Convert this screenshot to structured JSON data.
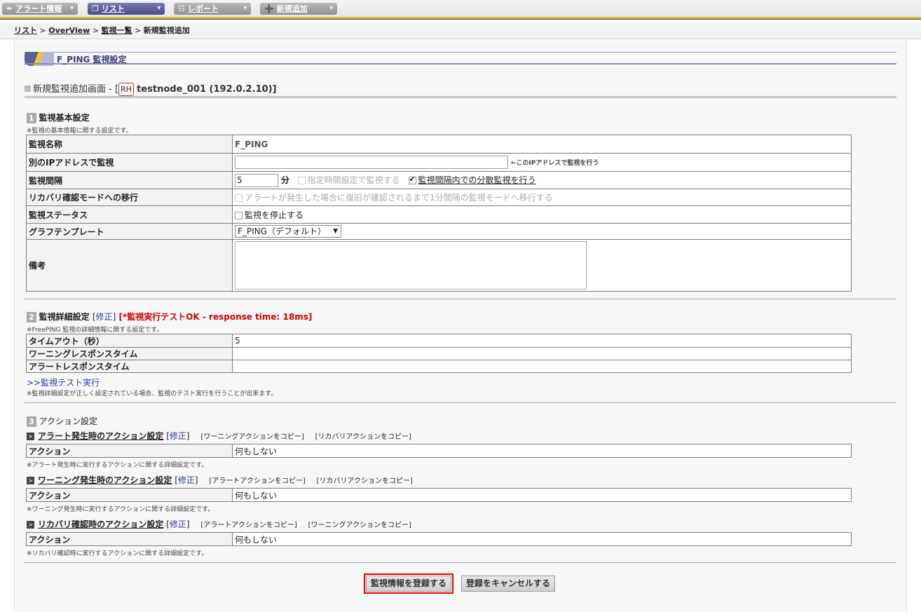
{
  "nav": {
    "tabs": [
      {
        "icon": "✒",
        "label": "アラート情報"
      },
      {
        "icon": "❐",
        "label": "リスト"
      },
      {
        "icon": "☷",
        "label": "レポート"
      },
      {
        "icon": "➕",
        "label": "新規追加"
      }
    ],
    "arrow": "▾"
  },
  "breadcrumb": {
    "items": [
      "リスト",
      "OverView",
      "監視一覧"
    ],
    "sep": ">",
    "current": "新規監視追加"
  },
  "page": {
    "title": "F_PING 監視設定",
    "subtitle_prefix": "新規監視追加画面 - [",
    "host_badge": "RH",
    "host_text": "testnode_001 (192.0.2.10)]"
  },
  "basic": {
    "num": "1",
    "title": "監視基本設定",
    "note": "※監視の基本情報に関する設定です。",
    "rows": {
      "name_label": "監視名称",
      "name_value": "F_PING",
      "altip_label": "別のIPアドレスで監視",
      "altip_hint": "←このIPアドレスで監視を行う",
      "interval_label": "監視間隔",
      "interval_value": "5",
      "interval_unit": "分",
      "interval_opt1": "指定時間設定で監視する",
      "interval_opt2": "監視間隔内での分散監視を行う",
      "recovery_label": "リカバリ確認モードへの移行",
      "recovery_opt": "アラートが発生した場合に復旧が確認されるまで1分間隔の監視モードへ移行する",
      "status_label": "監視ステータス",
      "status_opt": "監視を停止する",
      "graph_label": "グラフテンプレート",
      "graph_value": "F_PING（デフォルト）",
      "memo_label": "備考"
    }
  },
  "detail": {
    "num": "2",
    "title": "監視詳細設定",
    "edit": "修正",
    "test_result": "[*監視実行テストOK - response time: 18ms]",
    "note": "※FreePING 監視の詳細情報に関する設定です。",
    "rows": [
      {
        "label": "タイムアウト（秒）",
        "value": "5"
      },
      {
        "label": "ワーニングレスポンスタイム",
        "value": ""
      },
      {
        "label": "アラートレスポンスタイム",
        "value": ""
      }
    ],
    "test_link": ">>監視テスト実行",
    "test_note": "※監視詳細設定が正しく設定されている場合、監視のテスト実行を行うことが出来ます。"
  },
  "action": {
    "num": "3",
    "title": "アクション設定",
    "groups": [
      {
        "name": "アラート発生時のアクション設定",
        "edit": "修正",
        "copy1": "ワーニングアクションをコピー",
        "copy2": "リカバリアクションをコピー",
        "label": "アクション",
        "value": "何もしない",
        "note": "※アラート発生時に実行するアクションに関する詳細設定です。"
      },
      {
        "name": "ワーニング発生時のアクション設定",
        "edit": "修正",
        "copy1": "アラートアクションをコピー",
        "copy2": "リカバリアクションをコピー",
        "label": "アクション",
        "value": "何もしない",
        "note": "※ワーニング発生時に実行するアクションに関する詳細設定です。"
      },
      {
        "name": "リカバリ確認時のアクション設定",
        "edit": "修正",
        "copy1": "アラートアクションをコピー",
        "copy2": "ワーニングアクションをコピー",
        "label": "アクション",
        "value": "何もしない",
        "note": "※リカバリ確認時に実行するアクションに関する詳細設定です。"
      }
    ]
  },
  "buttons": {
    "submit": "監視情報を登録する",
    "cancel": "登録をキャンセルする"
  }
}
